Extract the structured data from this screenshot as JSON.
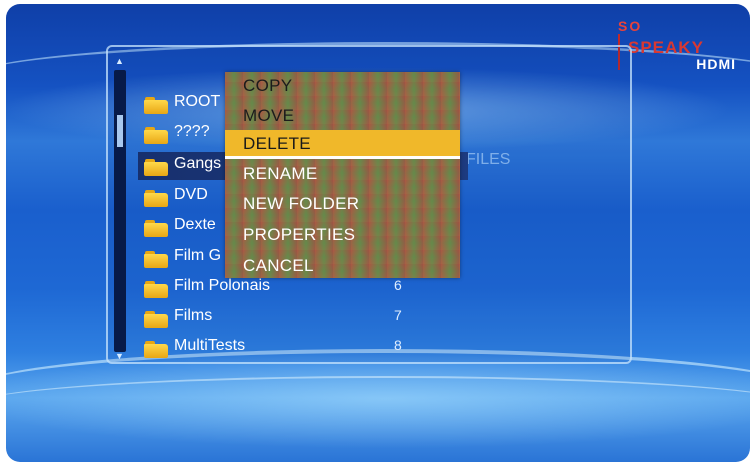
{
  "brand": {
    "line1": "SO",
    "line2": "SPEAKY",
    "line3": "HDMI"
  },
  "browser": {
    "column_label": "FILES",
    "folders": [
      {
        "name": "ROOT",
        "number": ""
      },
      {
        "name": "????",
        "number": ""
      },
      {
        "name": "Gangs",
        "number": ""
      },
      {
        "name": "DVD",
        "number": ""
      },
      {
        "name": "Dexte",
        "number": ""
      },
      {
        "name": "Film G",
        "number": ""
      },
      {
        "name": "Film Polonais",
        "number": "6"
      },
      {
        "name": "Films",
        "number": "7"
      },
      {
        "name": "MultiTests",
        "number": "8"
      }
    ],
    "selected_index": 2
  },
  "context_menu": {
    "items": [
      {
        "label": "COPY"
      },
      {
        "label": "MOVE"
      },
      {
        "label": "DELETE"
      },
      {
        "label": "RENAME"
      },
      {
        "label": "NEW FOLDER"
      },
      {
        "label": "PROPERTIES"
      },
      {
        "label": "CANCEL"
      }
    ],
    "highlighted_index": 2
  },
  "colors": {
    "highlight": "#f0b82a",
    "background": "#1a5fcd",
    "folder": "#ffd84a",
    "brand_red": "#d83832"
  },
  "icons": {
    "folder": "folder-icon",
    "scroll_up": "scroll-up-arrow-icon",
    "scroll_down": "scroll-down-arrow-icon"
  }
}
